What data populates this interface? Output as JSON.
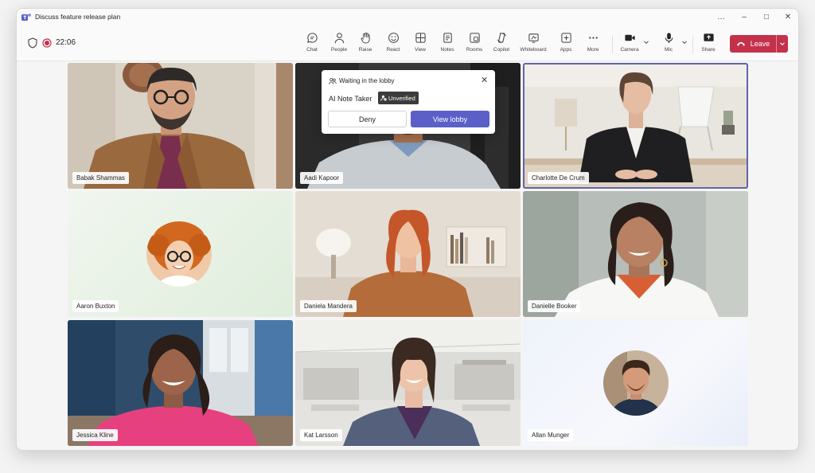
{
  "window": {
    "title": "Discuss feature release plan",
    "controls": [
      "…",
      "–",
      "□",
      "✕"
    ]
  },
  "meeting": {
    "timer": "22:06"
  },
  "toolbar": {
    "items": [
      {
        "id": "chat",
        "label": "Chat",
        "icon": "chat-icon"
      },
      {
        "id": "people",
        "label": "People",
        "icon": "people-icon"
      },
      {
        "id": "raise",
        "label": "Raise",
        "icon": "raise-hand-icon"
      },
      {
        "id": "react",
        "label": "React",
        "icon": "smiley-icon"
      },
      {
        "id": "view",
        "label": "View",
        "icon": "grid-view-icon"
      },
      {
        "id": "notes",
        "label": "Notes",
        "icon": "notes-icon"
      },
      {
        "id": "rooms",
        "label": "Rooms",
        "icon": "rooms-icon"
      },
      {
        "id": "copilot",
        "label": "Copilot",
        "icon": "copilot-icon"
      },
      {
        "id": "whiteboard",
        "label": "Whiteboard",
        "icon": "whiteboard-icon"
      },
      {
        "id": "apps",
        "label": "Apps",
        "icon": "apps-icon"
      },
      {
        "id": "more",
        "label": "More",
        "icon": "more-icon"
      }
    ],
    "camera_label": "Camera",
    "mic_label": "Mic",
    "share_label": "Share",
    "leave_label": "Leave"
  },
  "lobby": {
    "title": "Waiting in the lobby",
    "person": "AI Note Taker",
    "badge": "Unverified",
    "deny_label": "Deny",
    "view_label": "View lobby"
  },
  "participants": [
    {
      "name": "Babak Shammas"
    },
    {
      "name": "Aadi Kapoor"
    },
    {
      "name": "Charlotte De Crum",
      "active": true
    },
    {
      "name": "Aaron Buxton"
    },
    {
      "name": "Daniela Mandera"
    },
    {
      "name": "Danielle Booker"
    },
    {
      "name": "Jessica Kline"
    },
    {
      "name": "Kat Larsson"
    },
    {
      "name": "Allan Munger"
    }
  ],
  "colors": {
    "accent": "#5b5fc7",
    "leave": "#c4314b",
    "record": "#c4314b",
    "active_outline": "#6264a7"
  }
}
